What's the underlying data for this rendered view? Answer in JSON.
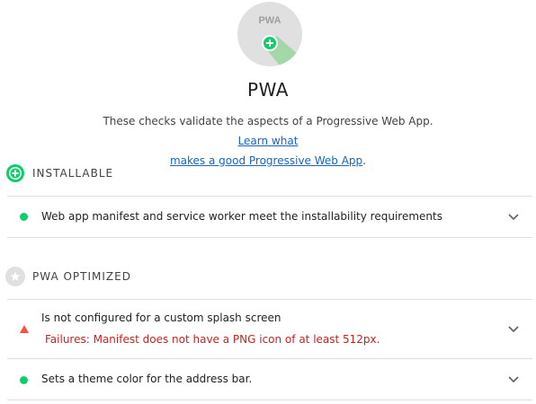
{
  "header": {
    "gauge_label": "PWA",
    "title": "PWA",
    "description": "These checks validate the aspects of a Progressive Web App.",
    "learn_more_line1": "Learn what",
    "learn_more_line2": "makes a good Progressive Web App",
    "learn_more_period": "."
  },
  "groups": [
    {
      "title": "INSTALLABLE",
      "icon": "plus-circle-icon",
      "color": "#0cce6b",
      "audits": [
        {
          "status": "pass",
          "title": "Web app manifest and service worker meet the installability requirements"
        }
      ]
    },
    {
      "title": "PWA OPTIMIZED",
      "icon": "star-circle-icon",
      "color": "#e0e0e0",
      "audits": [
        {
          "status": "fail",
          "title": "Is not configured for a custom splash screen",
          "failure": "Failures: Manifest does not have a PNG icon of at least 512px."
        },
        {
          "status": "pass",
          "title": "Sets a theme color for the address bar."
        }
      ]
    }
  ],
  "colors": {
    "pass": "#0cce6b",
    "fail": "#ff4e42",
    "failure_text": "#c7221f",
    "link": "#1565c0",
    "gauge_bg": "#e0e0e0"
  }
}
